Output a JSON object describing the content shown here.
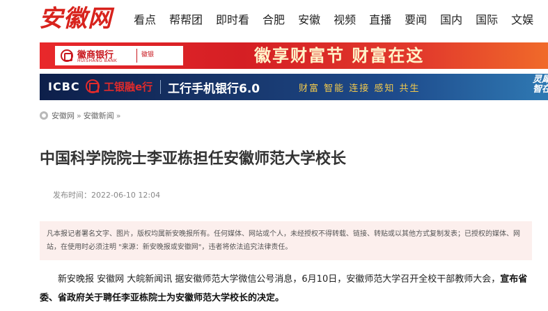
{
  "site": {
    "logo_text": "安徽网"
  },
  "nav": {
    "items": [
      "看点",
      "帮帮团",
      "即时看",
      "合肥",
      "安徽",
      "视频",
      "直播",
      "要闻",
      "国内",
      "国际",
      "文娱"
    ]
  },
  "banner_huishang": {
    "bank_name": "徽商银行",
    "bank_name_en": "HUISHANG BANK",
    "sub_label": "徽银",
    "slogan": "徽享财富节  财富在这"
  },
  "banner_icbc": {
    "icbc": "ICBC",
    "brand": "工银融e行",
    "title": "工行手机银行6.0",
    "tags": "财富 智能 连接 感知 共生",
    "corner": "灵犀\n智在"
  },
  "breadcrumb": {
    "items": [
      "安徽网",
      "安徽新闻"
    ],
    "separator": "»"
  },
  "article": {
    "headline": "中国科学院院士李亚栋担任安徽师范大学校长",
    "pubtime": "发布时间：2022-06-10 12:04",
    "notice": "凡本报记者署名文字、图片，版权均属新安晚报所有。任何媒体、网站或个人，未经授权不得转载、链接、转贴或以其他方式复制发表；已授权的媒体、网站，在使用时必须注明 \"来源：新安晚报或安徽网\"，违者将依法追究法律责任。",
    "body_lead": "新安晚报 安徽网 大皖新闻讯  据安徽师范大学微信公号消息，6月10日，安徽师范大学召开全校干部教师大会，",
    "body_bold": "宣布省委、省政府关于聘任李亚栋院士为安徽师范大学校长的决定。"
  },
  "colors": {
    "brand_red": "#d8231d",
    "notice_bg": "#fcefed",
    "banner_icbc_bg": "#173468"
  }
}
